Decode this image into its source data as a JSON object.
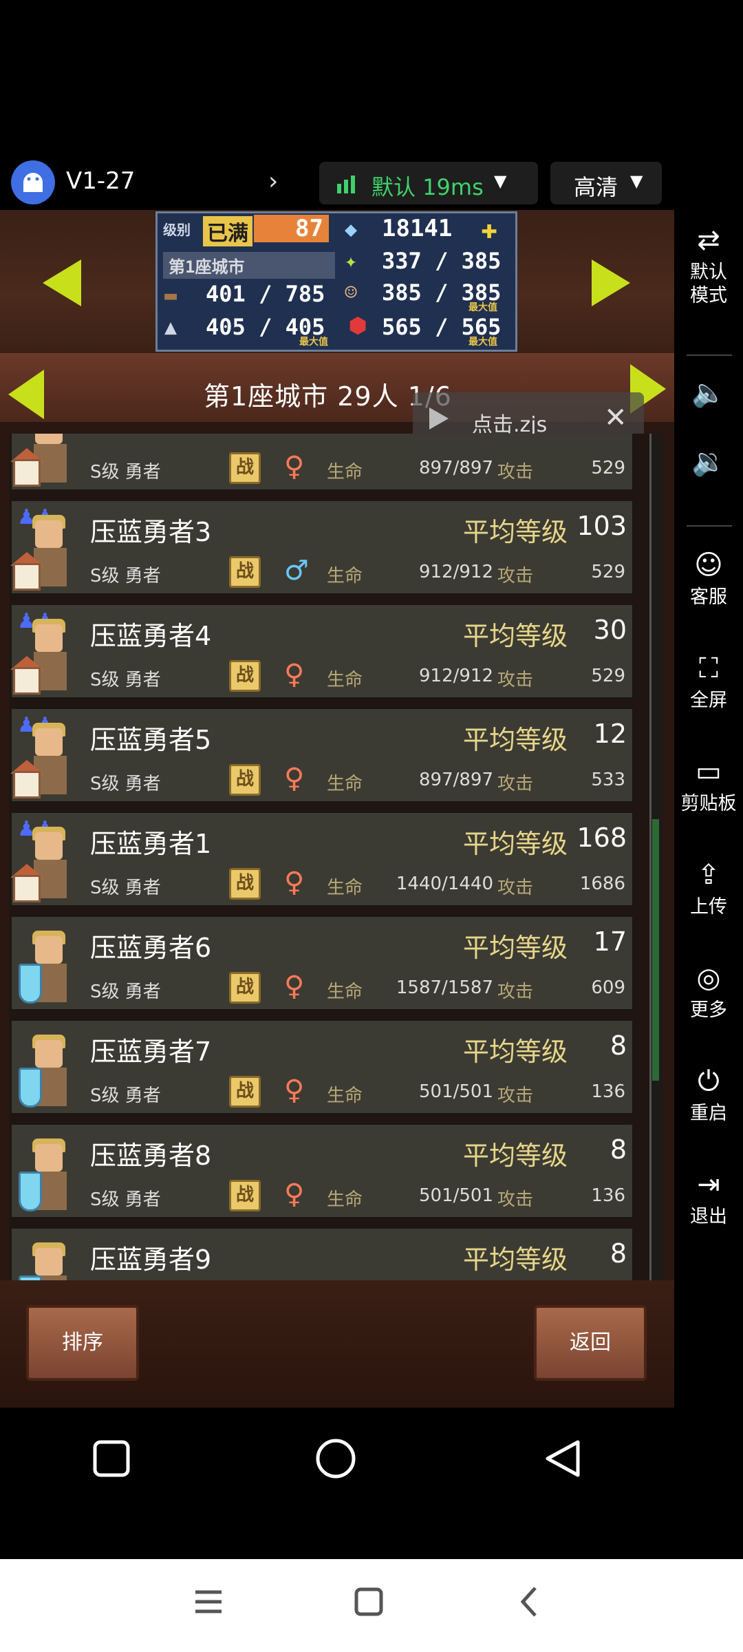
{
  "topbar": {
    "session_label": "V1-27",
    "net_label": "默认 19ms",
    "quality_label": "高清"
  },
  "stats": {
    "level_label": "级别",
    "level_status": "已满",
    "level_value": "87",
    "gems": "18141",
    "city_label": "第1座城市",
    "food": "337 / 385",
    "wood": "401 / 785",
    "pop": "385 / 385",
    "pop_max": "最大值",
    "stone": "405 / 405",
    "stone_max": "最大值",
    "ruby": "565 / 565",
    "ruby_max": "最大值"
  },
  "city_bar": {
    "title": "第1座城市  29人  1/6"
  },
  "overlay": {
    "text": "点击.zjs"
  },
  "list": {
    "avg_label": "平均等级",
    "rank_label": "S级 勇者",
    "badge_label": "战",
    "hp_label": "生命",
    "atk_label": "攻击",
    "rows": [
      {
        "name": "",
        "level": "",
        "hp": "897/897",
        "atk": "529",
        "gender": "♀"
      },
      {
        "name": "压蓝勇者3",
        "level": "103",
        "hp": "912/912",
        "atk": "529",
        "gender": "♂"
      },
      {
        "name": "压蓝勇者4",
        "level": "30",
        "hp": "912/912",
        "atk": "529",
        "gender": "♀"
      },
      {
        "name": "压蓝勇者5",
        "level": "12",
        "hp": "897/897",
        "atk": "533",
        "gender": "♀"
      },
      {
        "name": "压蓝勇者1",
        "level": "168",
        "hp": "1440/1440",
        "atk": "1686",
        "gender": "♀"
      },
      {
        "name": "压蓝勇者6",
        "level": "17",
        "hp": "1587/1587",
        "atk": "609",
        "gender": "♀"
      },
      {
        "name": "压蓝勇者7",
        "level": "8",
        "hp": "501/501",
        "atk": "136",
        "gender": "♀"
      },
      {
        "name": "压蓝勇者8",
        "level": "8",
        "hp": "501/501",
        "atk": "136",
        "gender": "♀"
      },
      {
        "name": "压蓝勇者9",
        "level": "8",
        "hp": "",
        "atk": "",
        "gender": ""
      }
    ]
  },
  "buttons": {
    "sort": "排序",
    "back": "返回"
  },
  "sidebar": {
    "items": [
      {
        "label": "默认\n模式",
        "icon": "swap-icon"
      },
      {
        "label": "",
        "icon": "volume-up-icon"
      },
      {
        "label": "",
        "icon": "volume-down-icon"
      },
      {
        "label": "客服",
        "icon": "support-icon"
      },
      {
        "label": "全屏",
        "icon": "fullscreen-icon"
      },
      {
        "label": "剪贴板",
        "icon": "clipboard-icon"
      },
      {
        "label": "上传",
        "icon": "upload-icon"
      },
      {
        "label": "更多",
        "icon": "more-icon"
      },
      {
        "label": "重启",
        "icon": "power-icon"
      },
      {
        "label": "退出",
        "icon": "exit-icon"
      }
    ]
  },
  "colors": {
    "accent_green": "#3fd26b",
    "arrow": "#c8e01c",
    "level_gold": "#e6d58a"
  }
}
